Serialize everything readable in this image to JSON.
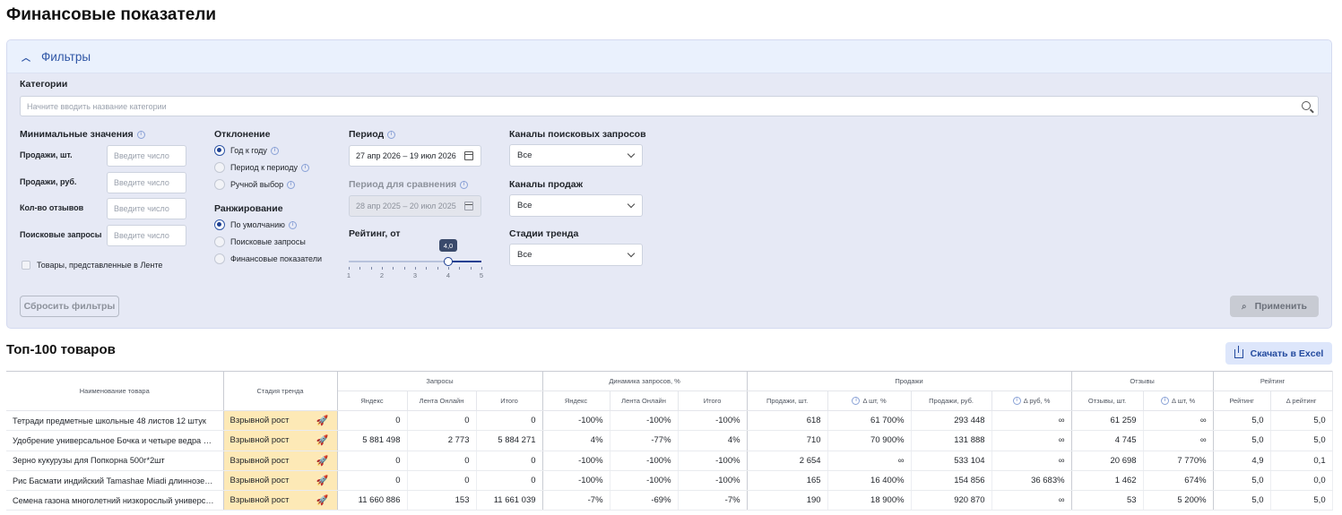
{
  "page": {
    "title": "Финансовые показатели"
  },
  "filters": {
    "header_label": "Фильтры",
    "categories_label": "Категории",
    "categories_placeholder": "Начните вводить название категории",
    "min_values": {
      "label": "Минимальные значения",
      "fields": [
        {
          "label": "Продажи, шт.",
          "placeholder": "Введите число"
        },
        {
          "label": "Продажи, руб.",
          "placeholder": "Введите число"
        },
        {
          "label": "Кол-во отзывов",
          "placeholder": "Введите число"
        },
        {
          "label": "Поисковые запросы",
          "placeholder": "Введите число"
        }
      ],
      "checkbox_label": "Товары, представленные в Ленте"
    },
    "deviation": {
      "label": "Отклонение",
      "options": [
        "Год к году",
        "Период к периоду",
        "Ручной выбор"
      ],
      "selected": "Год к году"
    },
    "ranking": {
      "label": "Ранжирование",
      "options": [
        "По умолчанию",
        "Поисковые запросы",
        "Финансовые показатели"
      ],
      "selected": "По умолчанию"
    },
    "period": {
      "label": "Период",
      "value": "27 апр 2026 – 19 июл 2026"
    },
    "compare_period": {
      "label": "Период для сравнения",
      "value": "28 апр 2025 – 20 июл 2025"
    },
    "rating": {
      "label": "Рейтинг, от",
      "value": "4,0",
      "level": 4,
      "min": 1,
      "max": 5,
      "ticks": [
        "1",
        "2",
        "3",
        "4",
        "5"
      ]
    },
    "search_channels": {
      "label": "Каналы поисковых запросов",
      "value": "Все"
    },
    "sales_channels": {
      "label": "Каналы продаж",
      "value": "Все"
    },
    "trend_stage": {
      "label": "Стадии тренда",
      "value": "Все"
    },
    "reset_label": "Сбросить фильтры",
    "apply_label": "Применить"
  },
  "top": {
    "title": "Топ-100 товаров",
    "excel_label": "Скачать в Excel",
    "groups": {
      "name": "Наименование товара",
      "stage": "Стадия тренда",
      "queries": "Запросы",
      "dynamics": "Динамика запросов, %",
      "sales": "Продажи",
      "reviews": "Отзывы",
      "rating": "Рейтинг"
    },
    "subcolumns": {
      "q_yandex": "Яндекс",
      "q_lenta": "Лента Онлайн",
      "q_total": "Итого",
      "d_yandex": "Яндекс",
      "d_lenta": "Лента Онлайн",
      "d_total": "Итого",
      "s_pcs": "Продажи, шт.",
      "s_dpcs": "Δ шт, %",
      "s_rub": "Продажи, руб.",
      "s_drub": "Δ руб, %",
      "r_pcs": "Отзывы, шт.",
      "r_dpcs": "Δ шт, %",
      "rt": "Рейтинг",
      "rt_d": "Δ рейтинг"
    },
    "rows": [
      {
        "name": "Тетради предметные школьные 48 листов 12 штук",
        "stage": "Взрывной рост",
        "v": [
          "0",
          "0",
          "0",
          "-100%",
          "-100%",
          "-100%",
          "618",
          "61 700%",
          "293 448",
          "∞",
          "61 259",
          "∞",
          "5,0",
          "5,0"
        ]
      },
      {
        "name": "Удобрение универсальное Бочка и четыре ведра Ому ...",
        "stage": "Взрывной рост",
        "v": [
          "5 881 498",
          "2 773",
          "5 884 271",
          "4%",
          "-77%",
          "4%",
          "710",
          "70 900%",
          "131 888",
          "∞",
          "4 745",
          "∞",
          "5,0",
          "5,0"
        ]
      },
      {
        "name": "Зерно кукурузы для Попкорна 500г*2шт",
        "stage": "Взрывной рост",
        "v": [
          "0",
          "0",
          "0",
          "-100%",
          "-100%",
          "-100%",
          "2 654",
          "∞",
          "533 104",
          "∞",
          "20 698",
          "7 770%",
          "4,9",
          "0,1"
        ]
      },
      {
        "name": "Рис Басмати индийский Tamashae Miadi длиннозерн...",
        "stage": "Взрывной рост",
        "v": [
          "0",
          "0",
          "0",
          "-100%",
          "-100%",
          "-100%",
          "165",
          "16 400%",
          "154 856",
          "36 683%",
          "1 462",
          "674%",
          "5,0",
          "0,0"
        ]
      },
      {
        "name": "Семена газона многолетний низкорослый универсал...",
        "stage": "Взрывной рост",
        "v": [
          "11 660 886",
          "153",
          "11 661 039",
          "-7%",
          "-69%",
          "-7%",
          "190",
          "18 900%",
          "920 870",
          "∞",
          "53",
          "5 200%",
          "5,0",
          "5,0"
        ]
      }
    ]
  }
}
